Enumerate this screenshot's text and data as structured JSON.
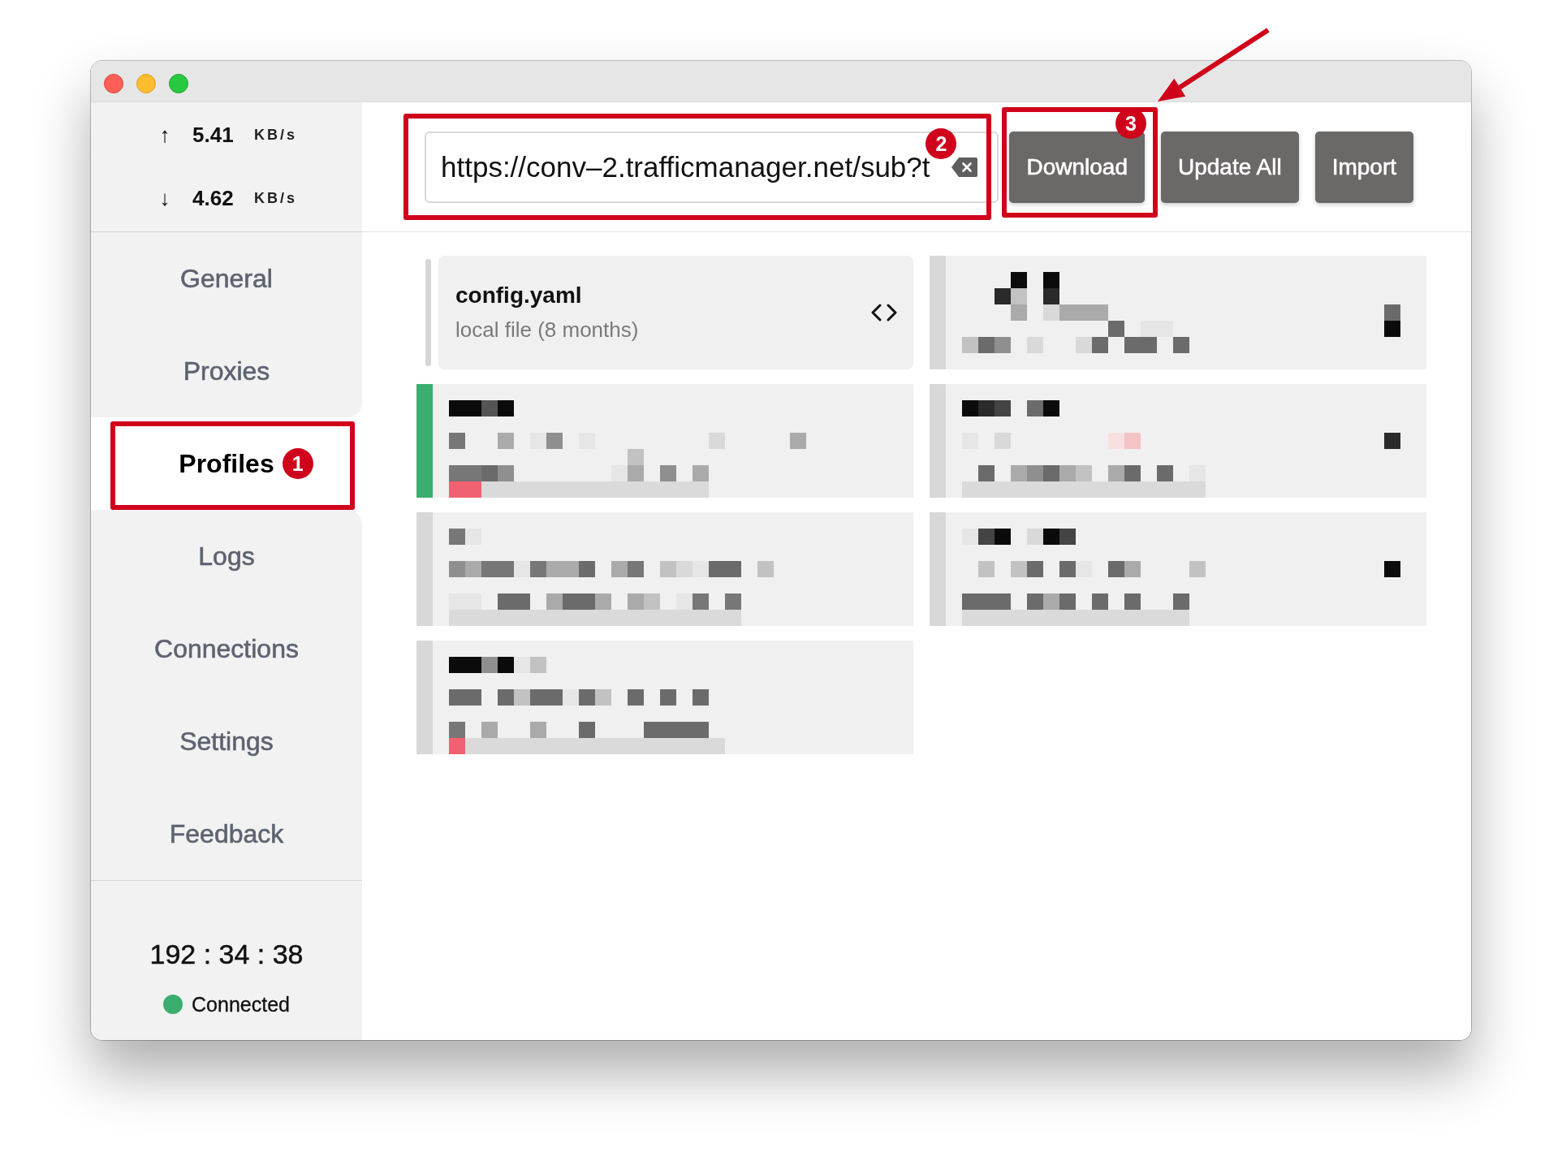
{
  "sidebar": {
    "traffic": [
      {
        "arrow": "↑",
        "value": "5.41",
        "unit": "KB/s"
      },
      {
        "arrow": "↓",
        "value": "4.62",
        "unit": "KB/s"
      }
    ],
    "nav_items": [
      {
        "label": "General",
        "selected": false
      },
      {
        "label": "Proxies",
        "selected": false
      },
      {
        "label": "Profiles",
        "selected": true,
        "callout": {
          "number": "1"
        }
      },
      {
        "label": "Logs",
        "selected": false
      },
      {
        "label": "Connections",
        "selected": false
      },
      {
        "label": "Settings",
        "selected": false
      },
      {
        "label": "Feedback",
        "selected": false
      }
    ],
    "uptime": "192 : 34 : 38",
    "status": {
      "label": "Connected",
      "connected": true
    }
  },
  "toolbar": {
    "url_field": {
      "value": "https://conv–2.trafficmanager.net/sub?t",
      "callout": {
        "number": "2"
      }
    },
    "buttons": [
      {
        "label": "Download",
        "callout": {
          "number": "3",
          "arrow": true
        }
      },
      {
        "label": "Update All"
      },
      {
        "label": "Import"
      }
    ]
  },
  "profiles": [
    {
      "kind": "file",
      "name": "config.yaml",
      "detail": "local file (8 months)",
      "selected": false
    },
    {
      "kind": "pixelated",
      "selected": false
    },
    {
      "kind": "pixelated",
      "selected": true
    },
    {
      "kind": "pixelated",
      "selected": false
    },
    {
      "kind": "pixelated",
      "selected": false
    },
    {
      "kind": "pixelated",
      "selected": false
    },
    {
      "kind": "pixelated",
      "selected": false
    }
  ]
}
